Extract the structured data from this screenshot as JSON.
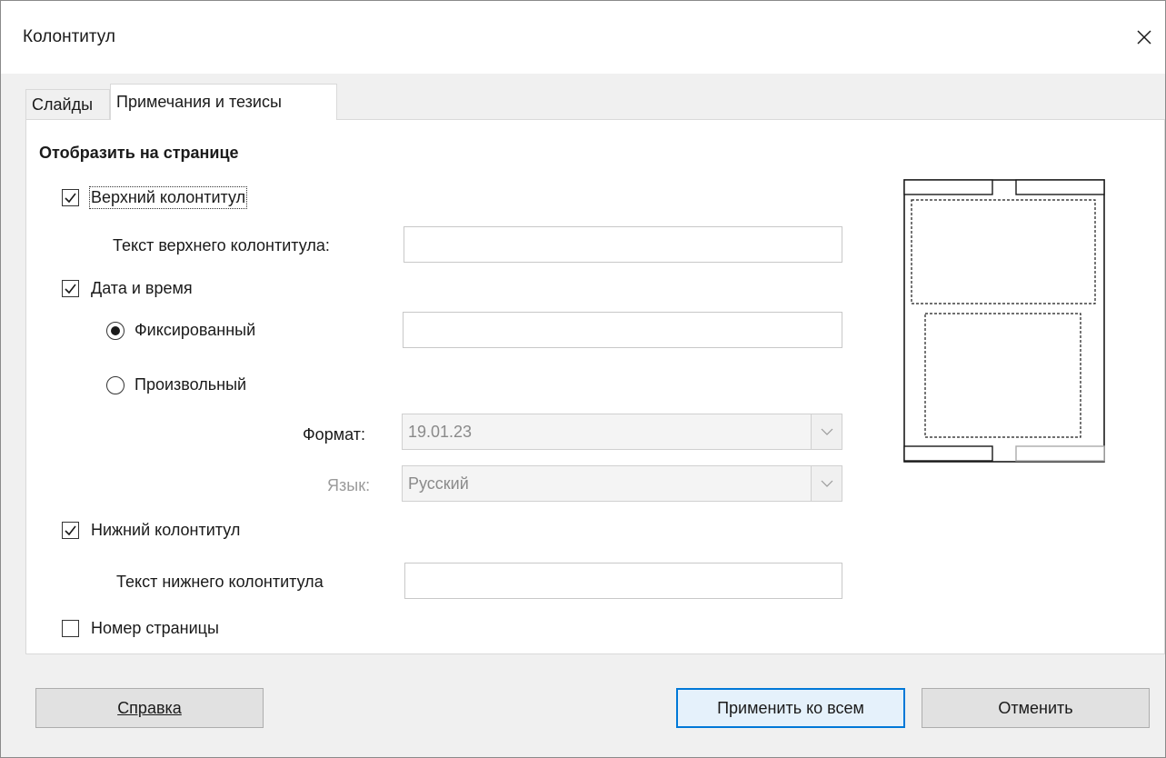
{
  "window": {
    "title": "Колонтитул",
    "close_icon": "close-icon"
  },
  "tabs": [
    {
      "label": "Слайды",
      "active": false
    },
    {
      "label": "Примечания и тезисы",
      "active": true
    }
  ],
  "section": {
    "title": "Отобразить на странице"
  },
  "header": {
    "checkbox_label": "Верхний колонтитул",
    "checked": true,
    "text_label": "Текст верхнего колонтитула:",
    "text_value": ""
  },
  "datetime": {
    "checkbox_label": "Дата и время",
    "checked": true,
    "fixed_label": "Фиксированный",
    "fixed_selected": true,
    "fixed_value": "",
    "variable_label": "Произвольный",
    "variable_selected": false,
    "format_label": "Формат:",
    "format_value": "19.01.23",
    "language_label": "Язык:",
    "language_value": "Русский"
  },
  "footer": {
    "checkbox_label": "Нижний колонтитул",
    "checked": true,
    "text_label": "Текст нижнего колонтитула",
    "text_value": ""
  },
  "page_number": {
    "checkbox_label": "Номер страницы",
    "checked": false
  },
  "buttons": {
    "help": "Справка",
    "apply_all": "Применить ко всем",
    "cancel": "Отменить"
  },
  "colors": {
    "accent": "#0078d7",
    "panel_bg": "#ffffff",
    "dialog_bg": "#f0f0f0"
  }
}
